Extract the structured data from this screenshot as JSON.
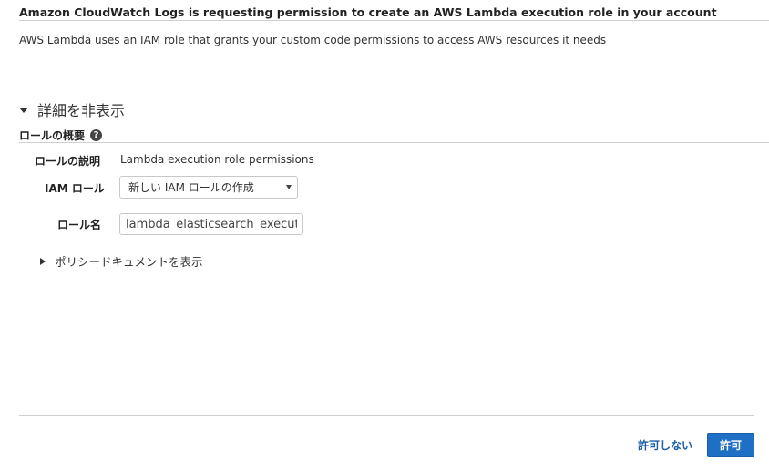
{
  "dialog": {
    "title": "Amazon CloudWatch Logs is requesting permission to create an AWS Lambda execution role in your account",
    "description": "AWS Lambda uses an IAM role that grants your custom code permissions to access AWS resources it needs"
  },
  "details": {
    "toggle_label": "詳細を非表示",
    "section_title": "ロールの概要",
    "help_icon_glyph": "?",
    "role_description_label": "ロールの説明",
    "role_description_value": "Lambda execution role permissions",
    "iam_role_label": "IAM ロール",
    "iam_role_selected": "新しい IAM ロールの作成",
    "role_name_label": "ロール名",
    "role_name_value": "lambda_elasticsearch_execution",
    "policy_toggle_label": "ポリシードキュメントを表示"
  },
  "footer": {
    "deny_label": "許可しない",
    "allow_label": "許可"
  },
  "colors": {
    "primary_button": "#1f6fc5",
    "link": "#1b5ea8",
    "divider": "#cfcfcf"
  },
  "icons": {
    "details_toggle": "caret-down-icon",
    "help": "help-circle-icon",
    "select_caret": "chevron-down-icon",
    "policy_toggle": "caret-right-icon"
  }
}
